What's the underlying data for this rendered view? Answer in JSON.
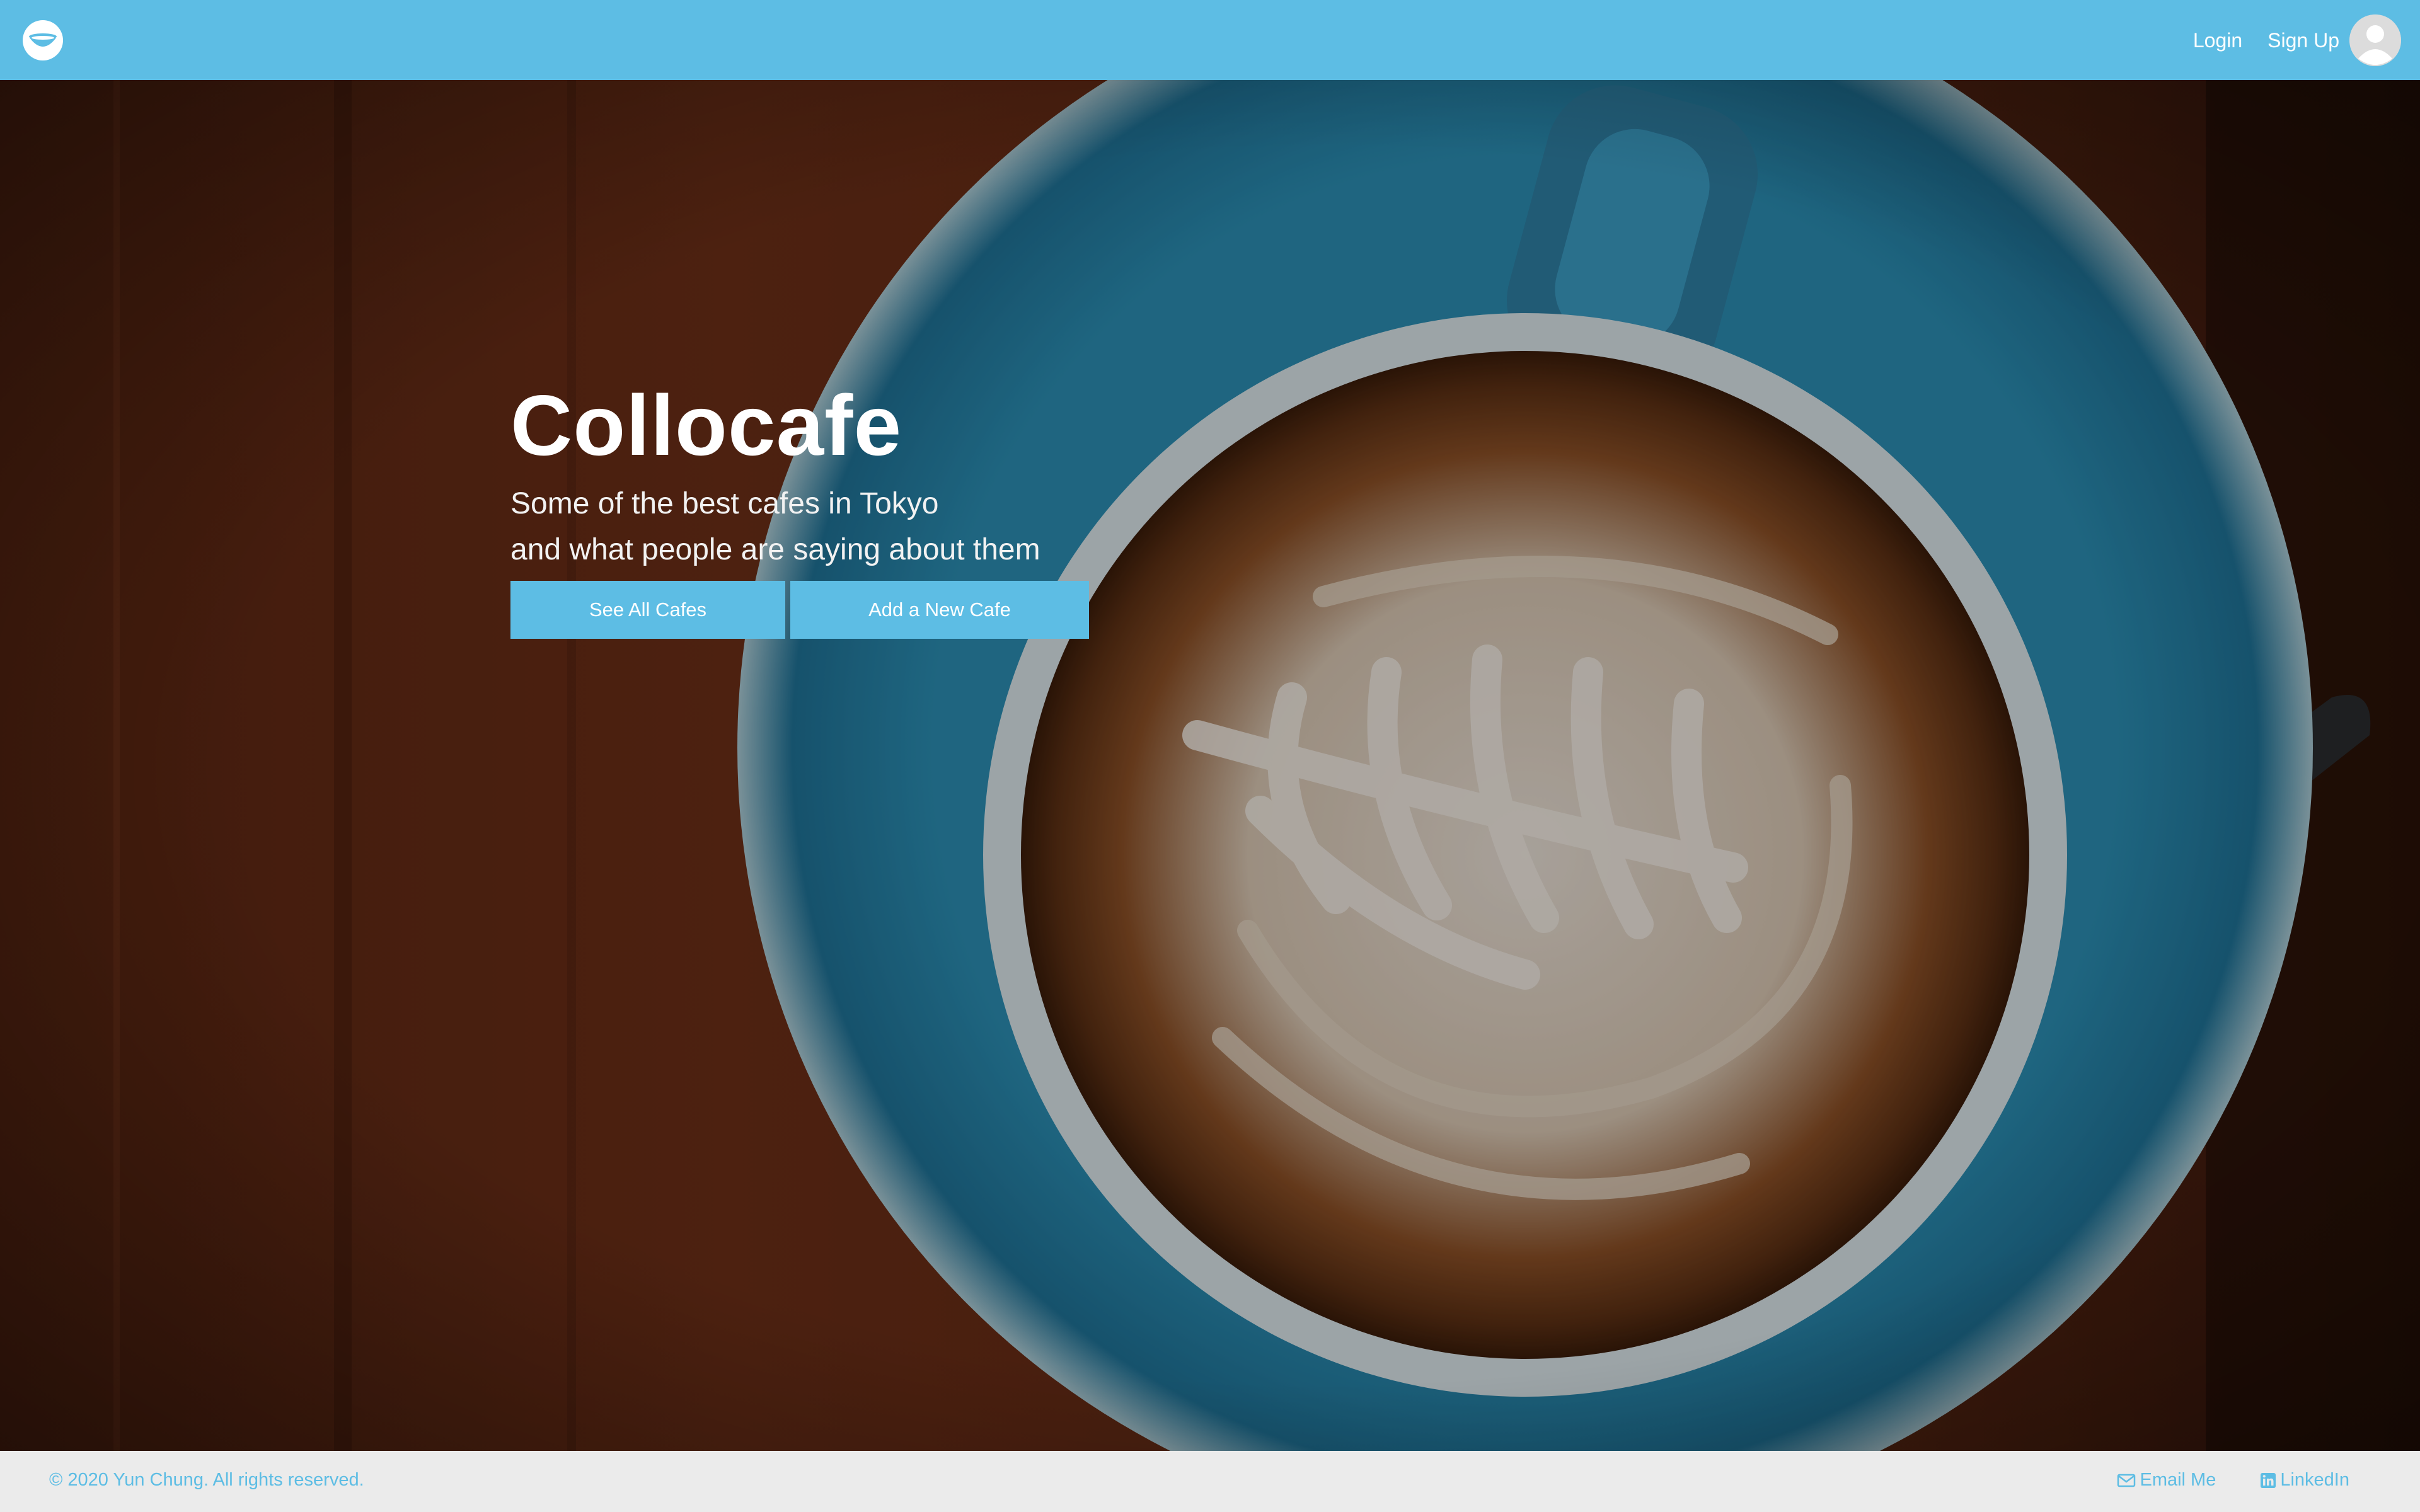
{
  "brand": {
    "icon": "coffee-cup-icon"
  },
  "nav": {
    "login_label": "Login",
    "signup_label": "Sign Up",
    "avatar_icon": "user-avatar-icon"
  },
  "hero": {
    "title": "Collocafe",
    "subtitle_line1": "Some of the best cafes in Tokyo",
    "subtitle_line2": "and what people are saying about them",
    "see_all_label": "See All Cafes",
    "add_new_label": "Add a New Cafe",
    "background": "latte-art-coffee-photo"
  },
  "footer": {
    "copyright": "© 2020 Yun Chung. All rights reserved.",
    "email_label": "Email Me",
    "email_icon": "envelope-icon",
    "linkedin_label": "LinkedIn",
    "linkedin_icon": "linkedin-icon"
  },
  "colors": {
    "accent": "#5dbde4",
    "footer_bg": "#ebebeb",
    "nav_text": "#ffffff"
  }
}
